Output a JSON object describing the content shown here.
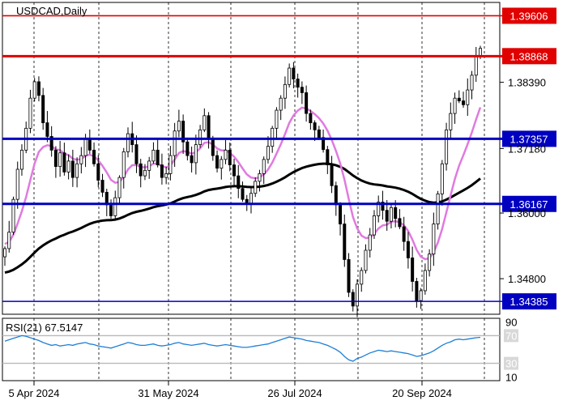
{
  "chart_data": [
    {
      "type": "candlestick",
      "symbol": "USDCAD",
      "timeframe": "Daily",
      "title": "USDCAD,Daily",
      "ylim": [
        1.3415,
        1.3985
      ],
      "x_dates": [
        "5 Apr 2024",
        "31 May 2024",
        "26 Jul 2024",
        "20 Sep 2024"
      ],
      "y_ticks": [
        1.3839,
        1.3718,
        1.36,
        1.348
      ],
      "y_tick_labels": [
        "1.38390",
        "1.37180",
        "1.36000",
        "1.34800"
      ],
      "levels": [
        {
          "value": 1.39606,
          "label": "1.39606",
          "color": "#e00000",
          "weight": "thin"
        },
        {
          "value": 1.38868,
          "label": "1.38868",
          "color": "#e00000",
          "weight": "thick"
        },
        {
          "value": 1.37357,
          "label": "1.37357",
          "color": "#0000c0",
          "weight": "thick"
        },
        {
          "value": 1.36167,
          "label": "1.36167",
          "color": "#0000c0",
          "weight": "thick"
        },
        {
          "value": 1.34385,
          "label": "1.34385",
          "color": "#0000c0",
          "weight": "thin"
        }
      ],
      "close_series": [
        1.3535,
        1.3565,
        1.3625,
        1.368,
        1.3715,
        1.3755,
        1.381,
        1.384,
        1.3815,
        1.3765,
        1.374,
        1.3715,
        1.3685,
        1.371,
        1.3675,
        1.3695,
        1.3665,
        1.369,
        1.3705,
        1.3735,
        1.3715,
        1.369,
        1.366,
        1.3638,
        1.3615,
        1.3595,
        1.3628,
        1.3665,
        1.3712,
        1.3745,
        1.3725,
        1.369,
        1.3668,
        1.3678,
        1.3695,
        1.3715,
        1.3688,
        1.3665,
        1.3672,
        1.3705,
        1.375,
        1.3768,
        1.373,
        1.3705,
        1.3692,
        1.3725,
        1.3752,
        1.3778,
        1.3735,
        1.3705,
        1.3682,
        1.3698,
        1.3715,
        1.3688,
        1.3668,
        1.3645,
        1.3625,
        1.3618,
        1.3636,
        1.3658,
        1.3672,
        1.3698,
        1.3722,
        1.3755,
        1.3788,
        1.381,
        1.3835,
        1.3865,
        1.3845,
        1.383,
        1.382,
        1.3782,
        1.3765,
        1.3752,
        1.3738,
        1.3716,
        1.3688,
        1.365,
        1.3615,
        1.358,
        1.3515,
        1.3455,
        1.343,
        1.347,
        1.3495,
        1.3532,
        1.356,
        1.3595,
        1.362,
        1.3605,
        1.3585,
        1.361,
        1.359,
        1.3575,
        1.3548,
        1.3518,
        1.3475,
        1.344,
        1.3458,
        1.3495,
        1.3525,
        1.358,
        1.3635,
        1.369,
        1.3752,
        1.3782,
        1.381,
        1.3805,
        1.3798,
        1.3825,
        1.3852,
        1.3888,
        1.3901
      ],
      "sma_fast": {
        "start": 1.3545,
        "path": "pink-smoothed"
      },
      "sma_slow": {
        "start": 1.349,
        "path": "black-smoothed"
      },
      "colors": {
        "bull": "#000000",
        "bear": "#000000",
        "ma_fast": "#e07ae0",
        "ma_slow": "#000000",
        "grid": "#000000"
      }
    },
    {
      "type": "line",
      "indicator": "RSI",
      "period": 21,
      "last_value": 67.5147,
      "title": "RSI(21) 67.5147",
      "ylim": [
        5,
        95
      ],
      "levels": [
        70,
        30
      ],
      "y_tick_labels": [
        "90",
        "70",
        "30",
        "10"
      ],
      "values": [
        62,
        64,
        66,
        68,
        70,
        69,
        67,
        65,
        63,
        60,
        58,
        56,
        57,
        55,
        56,
        57,
        56,
        58,
        59,
        60,
        58,
        57,
        55,
        54,
        53,
        52,
        54,
        56,
        58,
        60,
        59,
        57,
        56,
        56,
        57,
        58,
        56,
        55,
        56,
        57,
        59,
        60,
        58,
        57,
        56,
        57,
        58,
        59,
        57,
        56,
        55,
        56,
        57,
        56,
        55,
        54,
        53,
        53,
        54,
        55,
        56,
        57,
        58,
        60,
        62,
        64,
        66,
        68,
        67,
        66,
        65,
        63,
        62,
        61,
        60,
        58,
        56,
        53,
        50,
        46,
        40,
        35,
        33,
        37,
        39,
        42,
        45,
        47,
        49,
        48,
        47,
        48,
        47,
        46,
        45,
        44,
        42,
        40,
        41,
        43,
        45,
        48,
        52,
        56,
        59,
        61,
        64,
        65,
        64,
        65,
        66,
        67,
        67.5
      ]
    }
  ]
}
